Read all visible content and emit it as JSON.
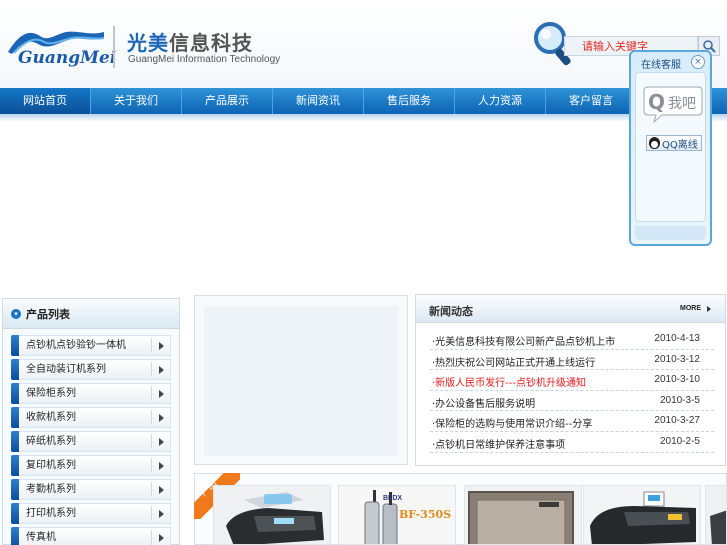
{
  "brand": {
    "logo_text": "GuangMei",
    "company_cn_accent": "光美",
    "company_cn_rest": "信息科技",
    "company_en": "GuangMei Information Technology"
  },
  "search": {
    "value": "请输入关键字"
  },
  "nav": {
    "items": [
      {
        "label": "网站首页"
      },
      {
        "label": "关于我们"
      },
      {
        "label": "产品展示"
      },
      {
        "label": "新闻资讯"
      },
      {
        "label": "售后服务"
      },
      {
        "label": "人力资源"
      },
      {
        "label": "客户留言"
      }
    ]
  },
  "kefu": {
    "title": "在线客服",
    "close": "×",
    "bubble_q": "Q",
    "bubble_text": "我吧",
    "qq_label": "QQ离线"
  },
  "products": {
    "title": "产品列表",
    "items": [
      {
        "label": "点钞机点钞验钞一体机"
      },
      {
        "label": "全自动装订机系列"
      },
      {
        "label": "保险柜系列"
      },
      {
        "label": "收款机系列"
      },
      {
        "label": "碎纸机系列"
      },
      {
        "label": "复印机系列"
      },
      {
        "label": "考勤机系列"
      },
      {
        "label": "打印机系列"
      },
      {
        "label": "传真机"
      }
    ]
  },
  "news": {
    "title": "新闻动态",
    "more": "MORE",
    "items": [
      {
        "title": "·光美信息科技有限公司新产品点钞机上市",
        "date": "2010-4-13",
        "hot": false
      },
      {
        "title": "·热烈庆祝公司网站正式开通上线运行",
        "date": "2010-3-12",
        "hot": false
      },
      {
        "title": "·新版人民币发行---点钞机升级通知",
        "date": "2010-3-10",
        "hot": true
      },
      {
        "title": "·办公设备售后服务说明",
        "date": "2010-3-5",
        "hot": false
      },
      {
        "title": "·保险柜的选购与使用常识介绍--分享",
        "date": "2010-3-27",
        "hot": false
      },
      {
        "title": "·点钞机日常维护保养注意事项",
        "date": "2010-2-5",
        "hot": false
      }
    ]
  },
  "showcase": {
    "ribbon": "产品",
    "walkie_brand": "BFDX",
    "walkie_model": "BF-350S"
  },
  "colors": {
    "nav_top": "#2f93d8",
    "nav_bottom": "#0d63b4",
    "accent_blue": "#1c64b5",
    "hot_red": "#e21a1a",
    "ribbon_orange": "#f07a1b"
  }
}
